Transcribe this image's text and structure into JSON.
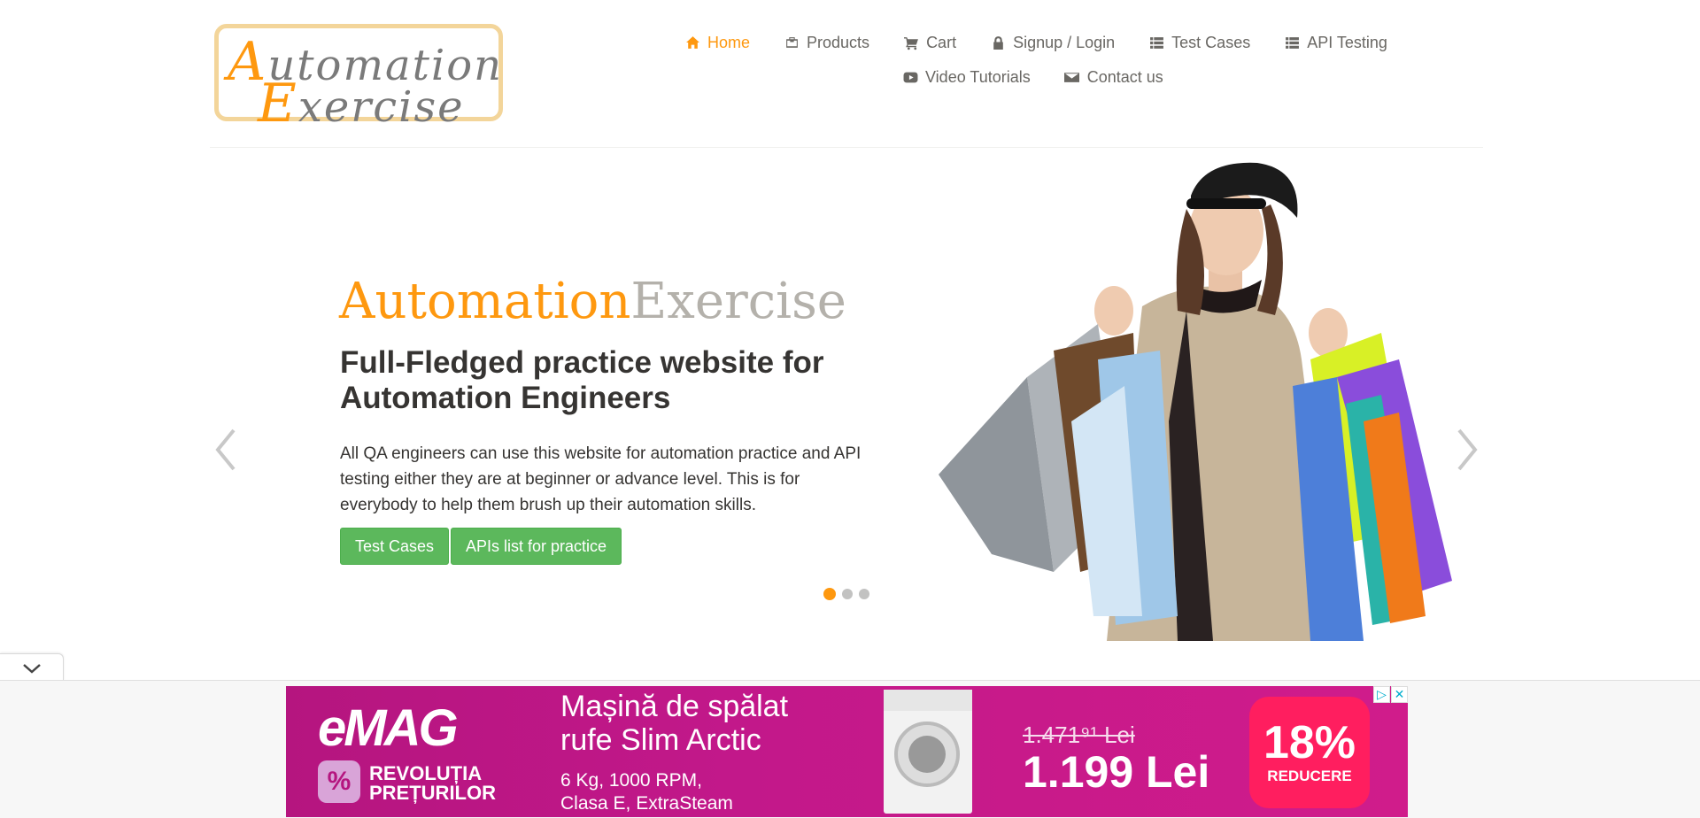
{
  "header": {
    "logo": {
      "line1_cap": "A",
      "line1_rest": "utomation",
      "line2_cap": "E",
      "line2_rest": "xercise"
    },
    "nav_row1": [
      {
        "label": "Home",
        "icon": "home-icon",
        "active": true
      },
      {
        "label": "Products",
        "icon": "products-icon"
      },
      {
        "label": "Cart",
        "icon": "cart-icon"
      },
      {
        "label": "Signup / Login",
        "icon": "lock-icon"
      },
      {
        "label": "Test Cases",
        "icon": "list-icon"
      },
      {
        "label": "API Testing",
        "icon": "list-icon"
      }
    ],
    "nav_row2": [
      {
        "label": "Video Tutorials",
        "icon": "youtube-icon"
      },
      {
        "label": "Contact us",
        "icon": "envelope-icon"
      }
    ]
  },
  "slider": {
    "brand_part1": "Automation",
    "brand_part2": "Exercise",
    "headline": "Full-Fledged practice website for Automation Engineers",
    "description": "All QA engineers can use this website for automation practice and API testing either they are at beginner or advance level. This is for everybody to help them brush up their automation skills.",
    "button_test_cases": "Test Cases",
    "button_apis": "APIs list for practice",
    "active_slide": 1,
    "slide_count": 3
  },
  "ad": {
    "brand": "eMAG",
    "tagline_line1": "REVOLUȚIA",
    "tagline_line2": "PREȚURILOR",
    "title_line1": "Mașină de spălat",
    "title_line2": "rufe Slim Arctic",
    "specs_line1": "6 Kg, 1000 RPM,",
    "specs_line2": "Clasa E, ExtraSteam",
    "old_price": "1.471⁹¹ Lei",
    "new_price": "1.199 Lei",
    "discount": "18%",
    "discount_label": "REDUCERE",
    "adchoices_label": "▷",
    "close_label": "✕"
  },
  "colors": {
    "accent": "#fe980f",
    "button_green": "#5cb85c",
    "ad_magenta": "#c2188a"
  }
}
